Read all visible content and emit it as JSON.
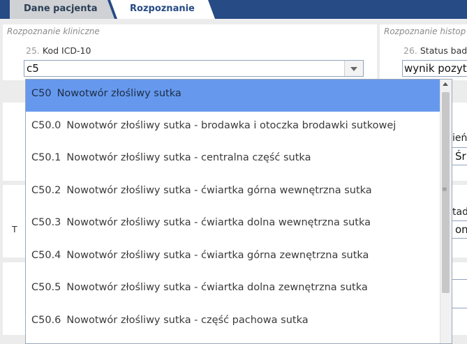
{
  "tabs": [
    {
      "label": "Dane pacjenta",
      "active": false
    },
    {
      "label": "Rozpoznanie",
      "active": true
    }
  ],
  "section_clinical": {
    "title": "Rozpoznanie kliniczne"
  },
  "section_hist": {
    "title": "Rozpoznanie histop"
  },
  "field_icd": {
    "number": "25.",
    "label": "Kod ICD-10",
    "value": "c5"
  },
  "field_status": {
    "number": "26.",
    "label": "Status bad",
    "value": "wynik pozytyw"
  },
  "background_fragments": {
    "left_letter": "T",
    "right_label_1": "ień",
    "right_value_1": "Śr",
    "right_label_2": "tad",
    "right_value_2": "ona"
  },
  "dropdown": {
    "options": [
      {
        "code": "C50",
        "label": "Nowotwór złośliwy sutka",
        "selected": true
      },
      {
        "code": "C50.0",
        "label": "Nowotwór złośliwy sutka - brodawka i otoczka brodawki sutkowej",
        "selected": false
      },
      {
        "code": "C50.1",
        "label": "Nowotwór złośliwy sutka - centralna część sutka",
        "selected": false
      },
      {
        "code": "C50.2",
        "label": "Nowotwór złośliwy sutka - ćwiartka górna wewnętrzna sutka",
        "selected": false
      },
      {
        "code": "C50.3",
        "label": "Nowotwór złośliwy sutka - ćwiartka dolna wewnętrzna sutka",
        "selected": false
      },
      {
        "code": "C50.4",
        "label": "Nowotwór złośliwy sutka - ćwiartka górna zewnętrzna sutka",
        "selected": false
      },
      {
        "code": "C50.5",
        "label": "Nowotwór złośliwy sutka - ćwiartka dolna zewnętrzna sutka",
        "selected": false
      },
      {
        "code": "C50.6",
        "label": "Nowotwór złośliwy sutka - część pachowa sutka",
        "selected": false
      }
    ]
  },
  "colors": {
    "header_bar": "#264b85",
    "selected_option": "#6699ee",
    "page_bg": "#ececec"
  },
  "icons": {
    "combo_toggle": "chevron-down-icon",
    "scroll_up": "arrow-up-icon",
    "scroll_grip": "grip-icon"
  }
}
